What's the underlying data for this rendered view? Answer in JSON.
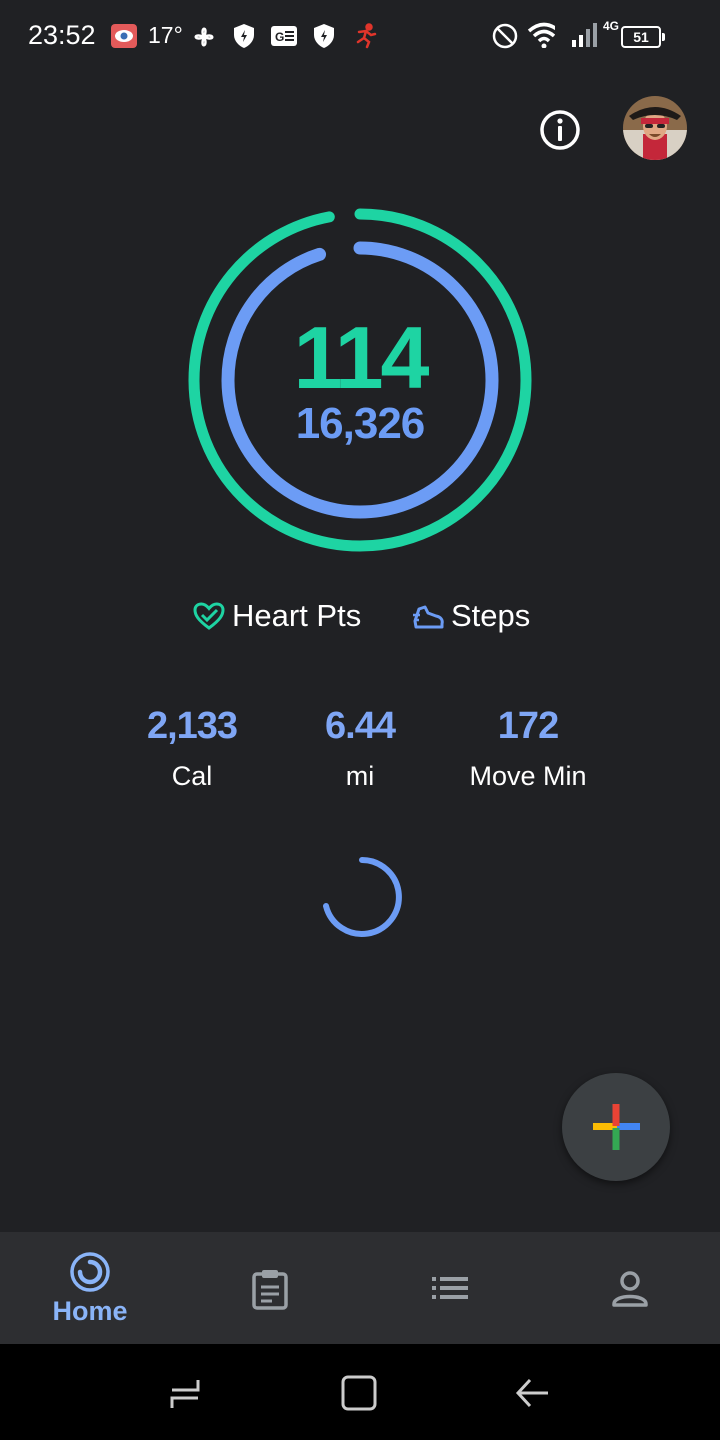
{
  "status_bar": {
    "time": "23:52",
    "temperature": "17°",
    "network": "4G",
    "battery": "51"
  },
  "header": {
    "info_icon": "info-icon",
    "avatar": "profile-avatar"
  },
  "goals": {
    "heart_points": "114",
    "steps": "16,326",
    "heart_points_color": "#1ed4a3",
    "steps_color": "#6c9cf5",
    "heart_points_progress": 0.97,
    "steps_progress": 0.95
  },
  "legend": {
    "heart_label": "Heart Pts",
    "steps_label": "Steps"
  },
  "stats": [
    {
      "value": "2,133",
      "label": "Cal"
    },
    {
      "value": "6.44",
      "label": "mi"
    },
    {
      "value": "172",
      "label": "Move Min"
    }
  ],
  "bottom_nav": {
    "items": [
      {
        "label": "Home",
        "icon": "home-ring-icon",
        "active": true
      },
      {
        "label": "",
        "icon": "journal-icon",
        "active": false
      },
      {
        "label": "",
        "icon": "browse-list-icon",
        "active": false
      },
      {
        "label": "",
        "icon": "profile-icon",
        "active": false
      }
    ]
  },
  "fab": {
    "icon": "add-plus-icon"
  },
  "system_nav": {
    "recents": "recents-icon",
    "home": "home-icon",
    "back": "back-icon"
  }
}
